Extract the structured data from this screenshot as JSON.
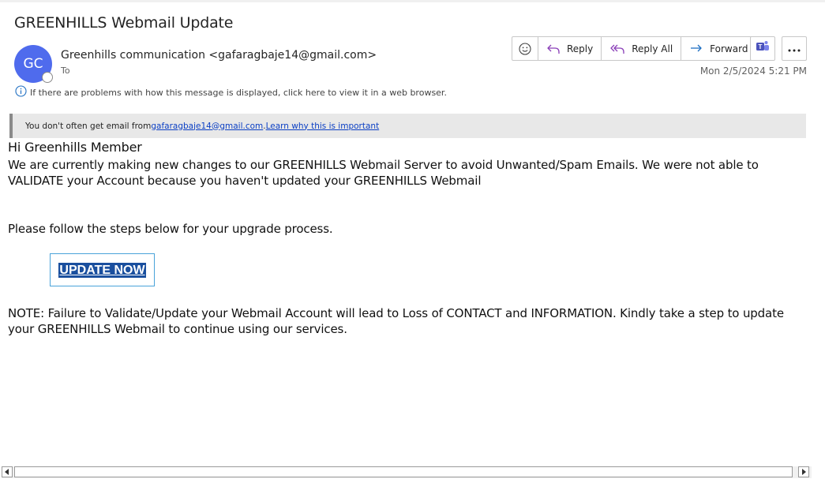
{
  "email": {
    "subject": "GREENHILLS Webmail Update",
    "avatar_initials": "GC",
    "sender": "Greenhills communication <gafaragbaje14@gmail.com>",
    "to_label": "To",
    "date": "Mon 2/5/2024 5:21 PM",
    "info_text": "If there are problems with how this message is displayed, click here to view it in a web browser."
  },
  "toolbar": {
    "reply_label": "Reply",
    "reply_all_label": "Reply All",
    "forward_label": "Forward"
  },
  "banner": {
    "prefix": "You don't often get email from ",
    "email_link": "gafaragbaje14@gmail.com",
    "separator": ". ",
    "learn_link": "Learn why this is important"
  },
  "body": {
    "greeting": "Hi Greenhills Member",
    "paragraph1": "We are currently making new changes to our GREENHILLS Webmail Server to avoid Unwanted/Spam Emails. We were not able to VALIDATE your Account because you haven't updated your GREENHILLS Webmail",
    "paragraph2": "Please follow the steps below for your upgrade process.",
    "cta_label": "UPDATE NOW",
    "note": "NOTE: Failure to Validate/Update your Webmail Account will lead to Loss of CONTACT and INFORMATION. Kindly take a step to update your GREENHILLS Webmail to continue using our services."
  },
  "colors": {
    "avatar": "#4f6bed",
    "cta_background": "#1a4f9e",
    "link": "#0b3fc4"
  }
}
